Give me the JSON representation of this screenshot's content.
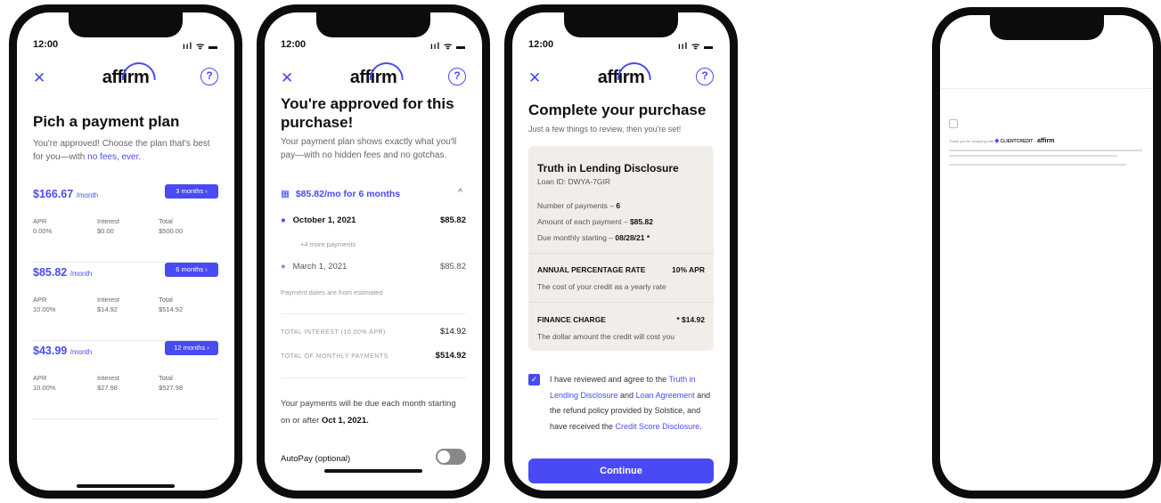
{
  "status_time": "12:00",
  "status_icons": "ııl ᯤ ▬",
  "brand": "affirm",
  "icons": {
    "close": "close-icon",
    "help": "help-icon",
    "calendar": "calendar-icon",
    "chevron": "chevron-up-icon"
  },
  "accent": "#4a4af4",
  "phone1": {
    "title": "Pich a payment plan",
    "subtitle_a": "You're approved! Choose the plan that's best for you—with ",
    "subtitle_link": "no fees, ever.",
    "col_labels": {
      "apr": "APR",
      "interest": "Interest",
      "total": "Total"
    },
    "per_month": "/month",
    "plans": [
      {
        "price": "$166.67",
        "pill": "3 months",
        "apr": "0.00%",
        "interest": "$0.00",
        "total": "$500.00"
      },
      {
        "price": "$85.82",
        "pill": "6 months",
        "apr": "10.00%",
        "interest": "$14.92",
        "total": "$514.92"
      },
      {
        "price": "$43.99",
        "pill": "12 months",
        "apr": "10.00%",
        "interest": "$27.98",
        "total": "$527.98"
      }
    ]
  },
  "phone2": {
    "title": "You're approved for this purchase!",
    "subtitle": "Your payment plan shows exactly what you'll pay—with no hidden fees and no gotchas.",
    "plan_summary": "$85.82/mo for 6 months",
    "first_date": "October 1, 2021",
    "first_amount": "$85.82",
    "more_payments": "+4 more payments",
    "last_date": "March 1, 2021",
    "last_amount": "$85.82",
    "note": "Payment dates are from estimated",
    "total_interest_label": "TOTAL INTEREST (10.00% APR)",
    "total_interest": "$14.92",
    "total_payments_label": "TOTAL OF MONTHLY PAYMENTS",
    "total_payments": "$514.92",
    "due_text": "Your payments will be due each month starting on or after ",
    "due_date": "Oct 1, 2021.",
    "autopay": "AutoPay (optional)"
  },
  "phone3": {
    "title": "Complete your purchase",
    "subtitle": "Just a few things to review, then you're set!",
    "tila_title": "Truth in Lending Disclosure",
    "loan_id": "Loan ID: DWYA-7GIR",
    "num_payments_label": "Number of payments – ",
    "num_payments": "6",
    "amount_label": "Amount of each payment – ",
    "amount": "$85.82",
    "due_label": "Due monthly starting – ",
    "due": "08/28/21 *",
    "apr_label": "ANNUAL PERCENTAGE RATE",
    "apr_value": "10% APR",
    "apr_desc": "The cost of your credit as a yearly rate",
    "fin_label": "FINANCE CHARGE",
    "fin_value": "* $14.92",
    "fin_desc": "The dollar amount the credit will cost you",
    "agree_1": "I have reviewed and agree to the ",
    "agree_link1": "Truth in Lending Disclosure",
    "agree_2": " and ",
    "agree_link2": "Loan Agreement",
    "agree_3": " and the refund policy provided by Solstice, and have received the ",
    "agree_link3": "Credit Score Disclosure",
    "agree_4": ".",
    "button": "Continue"
  },
  "phone4": {
    "thanks": "Thank you for shopping with",
    "client": "CLIENTCREDIT",
    "x": "×",
    "brand": "affirm"
  }
}
